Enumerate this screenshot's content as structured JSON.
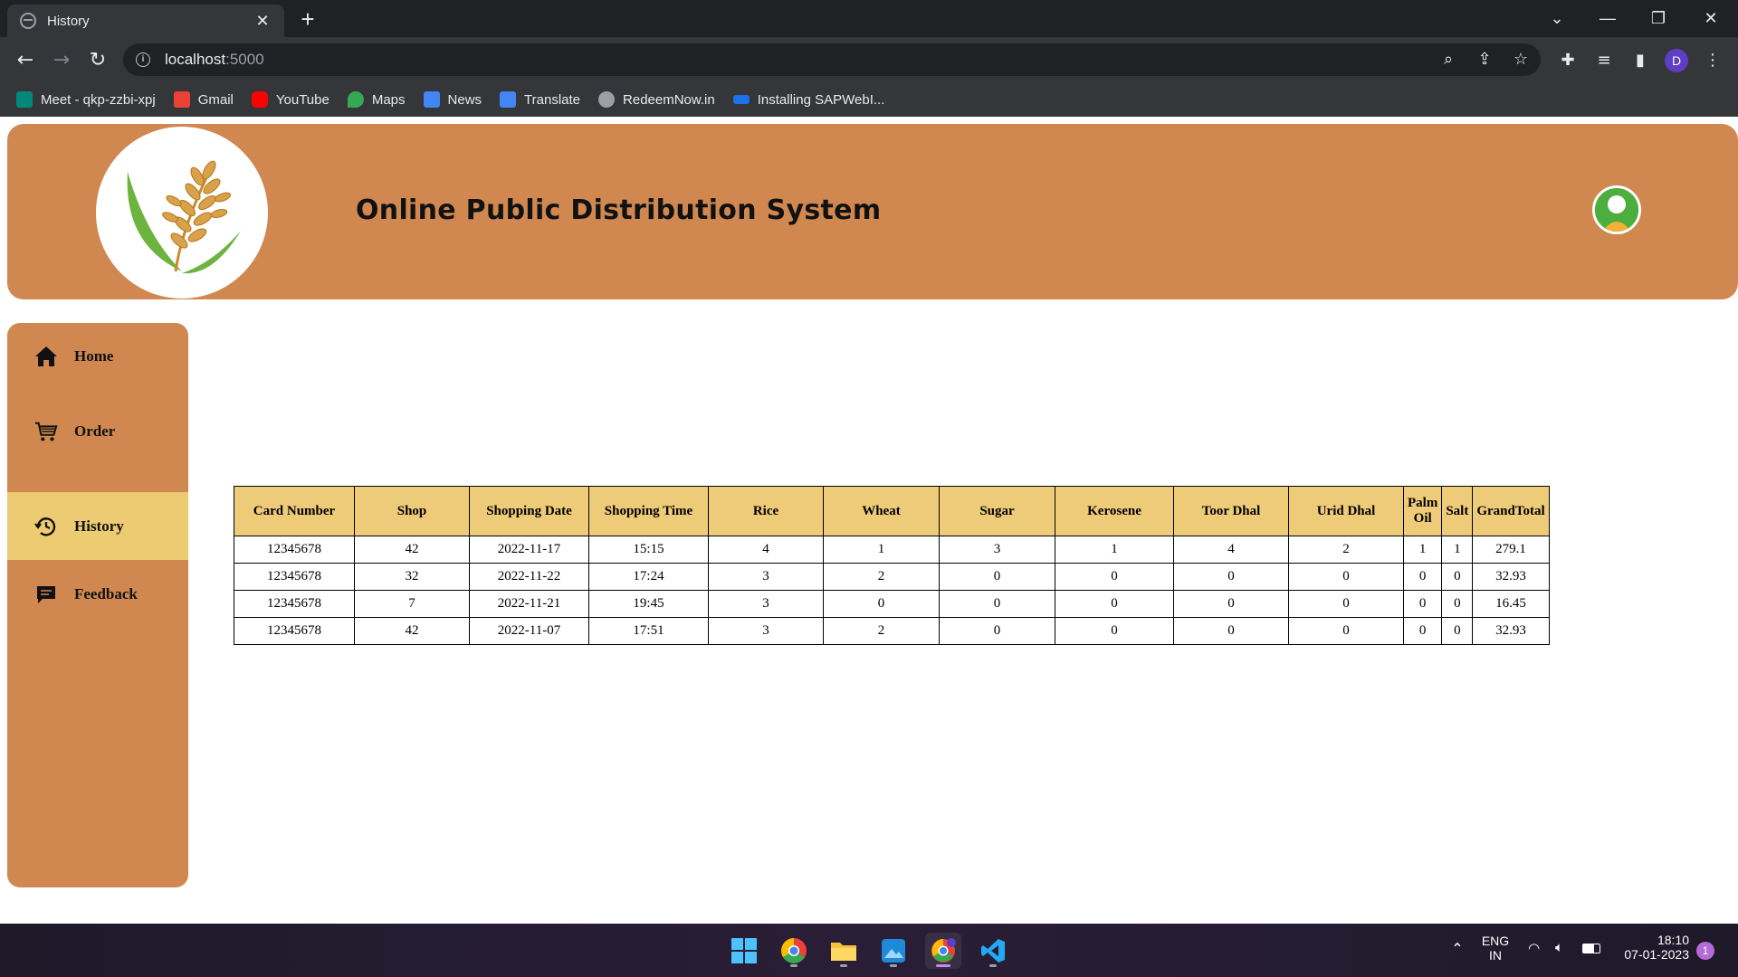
{
  "browser": {
    "tab_title": "History",
    "url_host": "localhost",
    "url_port": ":5000",
    "profile_initial": "D",
    "bookmarks": [
      {
        "label": "Meet - qkp-zzbi-xpj",
        "icon": "meet-icon",
        "color": "#00897b"
      },
      {
        "label": "Gmail",
        "icon": "gmail-icon",
        "color": "#ea4335"
      },
      {
        "label": "YouTube",
        "icon": "youtube-icon",
        "color": "#ff0000"
      },
      {
        "label": "Maps",
        "icon": "maps-icon",
        "color": "#34a853"
      },
      {
        "label": "News",
        "icon": "news-icon",
        "color": "#4285f4"
      },
      {
        "label": "Translate",
        "icon": "translate-icon",
        "color": "#4285f4"
      },
      {
        "label": "RedeemNow.in",
        "icon": "globe-icon",
        "color": "#9aa0a6"
      },
      {
        "label": "Installing SAPWebI...",
        "icon": "sap-icon",
        "color": "#1a73e8"
      }
    ]
  },
  "header": {
    "title": "Online Public Distribution System",
    "bg_color": "#d08850"
  },
  "sidebar": {
    "items": [
      {
        "label": "Home",
        "icon": "home-icon",
        "active": false
      },
      {
        "label": "Order",
        "icon": "cart-icon",
        "active": false
      },
      {
        "label": "History",
        "icon": "history-icon",
        "active": true
      },
      {
        "label": "Feedback",
        "icon": "feedback-icon",
        "active": false
      }
    ],
    "active_color": "#eccb72"
  },
  "history_table": {
    "columns": [
      "Card Number",
      "Shop",
      "Shopping Date",
      "Shopping Time",
      "Rice",
      "Wheat",
      "Sugar",
      "Kerosene",
      "Toor Dhal",
      "Urid Dhal",
      "Palm Oil",
      "Salt",
      "GrandTotal"
    ],
    "rows": [
      [
        "12345678",
        "42",
        "2022-11-17",
        "15:15",
        "4",
        "1",
        "3",
        "1",
        "4",
        "2",
        "1",
        "1",
        "279.1"
      ],
      [
        "12345678",
        "32",
        "2022-11-22",
        "17:24",
        "3",
        "2",
        "0",
        "0",
        "0",
        "0",
        "0",
        "0",
        "32.93"
      ],
      [
        "12345678",
        "7",
        "2022-11-21",
        "19:45",
        "3",
        "0",
        "0",
        "0",
        "0",
        "0",
        "0",
        "0",
        "16.45"
      ],
      [
        "12345678",
        "42",
        "2022-11-07",
        "17:51",
        "3",
        "2",
        "0",
        "0",
        "0",
        "0",
        "0",
        "0",
        "32.93"
      ]
    ]
  },
  "taskbar": {
    "language_line1": "ENG",
    "language_line2": "IN",
    "time": "18:10",
    "date": "07-01-2023",
    "notification_count": "1"
  }
}
